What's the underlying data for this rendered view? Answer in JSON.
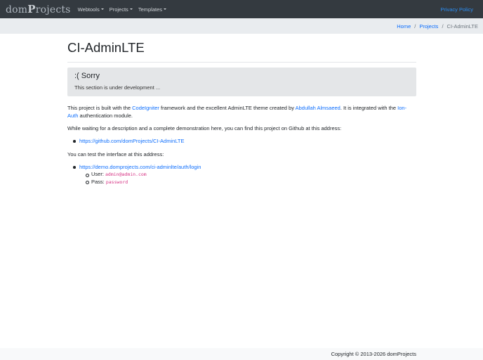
{
  "navbar": {
    "brand": {
      "prefix": "dom",
      "suffix": "rojects",
      "initial": "P"
    },
    "items": [
      {
        "label": "Webtools"
      },
      {
        "label": "Projects"
      },
      {
        "label": "Templates"
      }
    ],
    "right_link": "Privacy Policy"
  },
  "breadcrumb": {
    "items": [
      "Home",
      "Projects"
    ],
    "active": "CI-AdminLTE",
    "separator": "/"
  },
  "page": {
    "title": "CI-AdminLTE",
    "notice": {
      "heading": ":( Sorry",
      "text": "This section is under development ..."
    },
    "para1": {
      "t1": "This project is built with the ",
      "link1": "CodeIgniter",
      "t2": " framework and the excellent AdminLTE theme created by ",
      "link2": "Abdullah Almsaeed",
      "t3": ". It is integrated with the ",
      "link3": "Ion-Auth",
      "t4": " authentication module."
    },
    "para2": "While waiting for a description and a complete demonstration here, you can find this project on Github at this address:",
    "github_link": "https://github.com/domProjects/CI-AdminLTE",
    "para3": "You can test the interface at this address:",
    "demo_link": "https://demo.domprojects.com/ci-adminlte/auth/login",
    "user_label": "User: ",
    "user_value": "admin@admin.com",
    "pass_label": "Pass: ",
    "pass_value": "password"
  },
  "footer": {
    "copyright": "Copyright © 2013-2026 domProjects"
  },
  "colors": {
    "navbar_bg": "#343a40",
    "link": "#0d6efd",
    "breadcrumb_bg": "#e9ecef",
    "notice_bg": "#e4e6e8",
    "code": "#d63384"
  }
}
